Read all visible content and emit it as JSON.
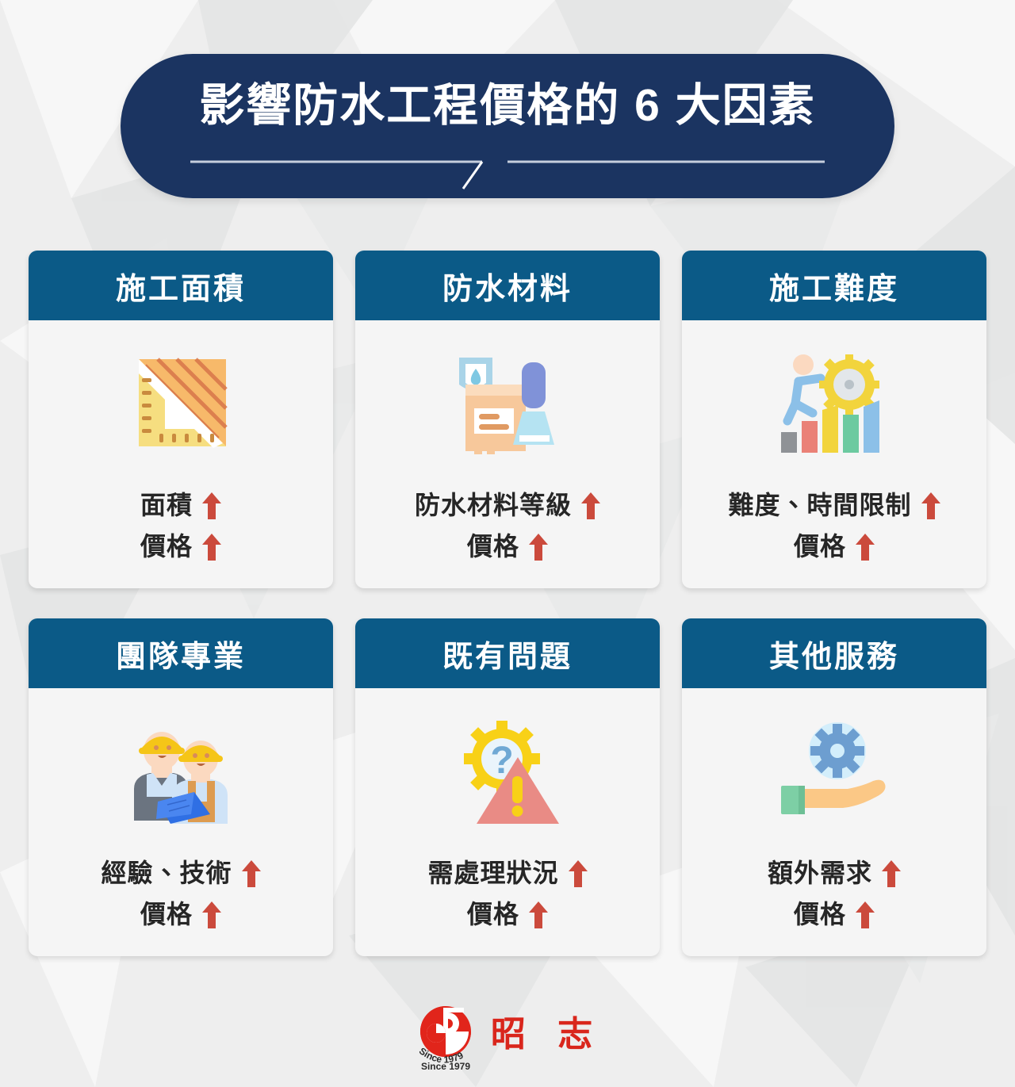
{
  "header": {
    "title": "影響防水工程價格的 6 大因素",
    "divider_icon": "split-rule-divider"
  },
  "colors": {
    "background": "#eeeeee",
    "banner_navy": "#1b3461",
    "card_header_blue": "#0b5a87",
    "card_body": "#f5f5f5",
    "arrow_red": "#cb4a3c",
    "body_text": "#262626",
    "logo_red": "#d9261c"
  },
  "cards": [
    {
      "header": "施工面積",
      "icon": "ruler-triangle-area-icon",
      "lines": [
        "面積",
        "價格"
      ],
      "arrows": [
        "up-arrow-icon",
        "up-arrow-icon"
      ]
    },
    {
      "header": "防水材料",
      "icon": "waterproof-material-box-icon",
      "lines": [
        "防水材料等級",
        "價格"
      ],
      "arrows": [
        "up-arrow-icon",
        "up-arrow-icon"
      ]
    },
    {
      "header": "施工難度",
      "icon": "person-climbing-bar-chart-gear-icon",
      "lines": [
        "難度、時間限制",
        "價格"
      ],
      "arrows": [
        "up-arrow-icon",
        "up-arrow-icon"
      ]
    },
    {
      "header": "團隊專業",
      "icon": "construction-workers-blueprint-icon",
      "lines": [
        "經驗、技術",
        "價格"
      ],
      "arrows": [
        "up-arrow-icon",
        "up-arrow-icon"
      ]
    },
    {
      "header": "既有問題",
      "icon": "gear-question-warning-triangle-icon",
      "lines": [
        "需處理狀況",
        "價格"
      ],
      "arrows": [
        "up-arrow-icon",
        "up-arrow-icon"
      ]
    },
    {
      "header": "其他服務",
      "icon": "hand-holding-gear-icon",
      "lines": [
        "額外需求",
        "價格"
      ],
      "arrows": [
        "up-arrow-icon",
        "up-arrow-icon"
      ]
    }
  ],
  "footer": {
    "logo_icon": "chao-chih-circular-logo",
    "logo_since": "Since 1979",
    "brand_name": "昭 志"
  }
}
